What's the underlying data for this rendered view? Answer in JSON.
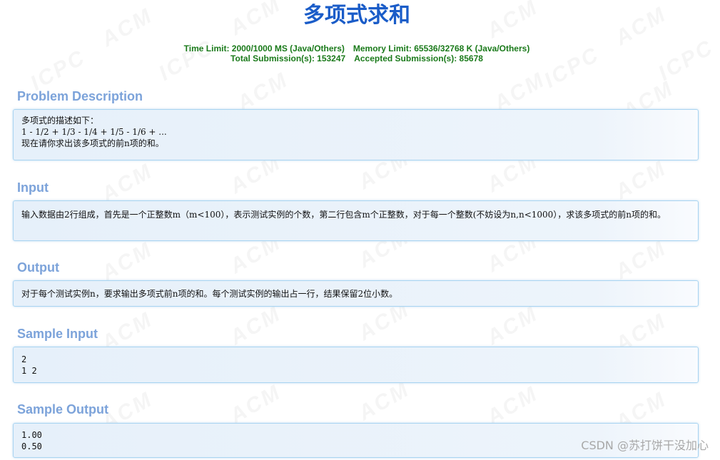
{
  "problem": {
    "title": "多项式求和",
    "limits": {
      "time_limit": "Time Limit: 2000/1000 MS (Java/Others)",
      "memory_limit": "Memory Limit: 65536/32768 K (Java/Others)",
      "total_submissions": "Total Submission(s): 153247",
      "accepted_submissions": "Accepted Submission(s): 85678"
    }
  },
  "sections": {
    "description": {
      "heading": "Problem Description",
      "lines": [
        "多项式的描述如下：",
        "1 - 1/2 + 1/3 - 1/4 + 1/5 - 1/6 + ...",
        "现在请你求出该多项式的前n项的和。"
      ]
    },
    "input": {
      "heading": "Input",
      "lines": [
        "输入数据由2行组成，首先是一个正整数m（m<100），表示测试实例的个数，第二行包含m个正整数，对于每一个整数(不妨设为n,n<1000），求该多项式的前n项的和。"
      ]
    },
    "output": {
      "heading": "Output",
      "lines": [
        "对于每个测试实例n，要求输出多项式前n项的和。每个测试实例的输出占一行，结果保留2位小数。"
      ]
    },
    "sample_input": {
      "heading": "Sample Input",
      "lines": [
        "2",
        "1 2"
      ]
    },
    "sample_output": {
      "heading": "Sample Output",
      "lines": [
        "1.00",
        "0.50"
      ]
    }
  },
  "watermark": {
    "text_acm": "ACM",
    "text_icpc": "ICPC"
  },
  "credit": "CSDN @苏打饼干没加心",
  "colors": {
    "title": "#1a5cc8",
    "limits": "#1a7a1a",
    "section_heading": "#7ca3da",
    "panel_border": "#a9d4f1",
    "panel_background": "#e6f0fa"
  }
}
